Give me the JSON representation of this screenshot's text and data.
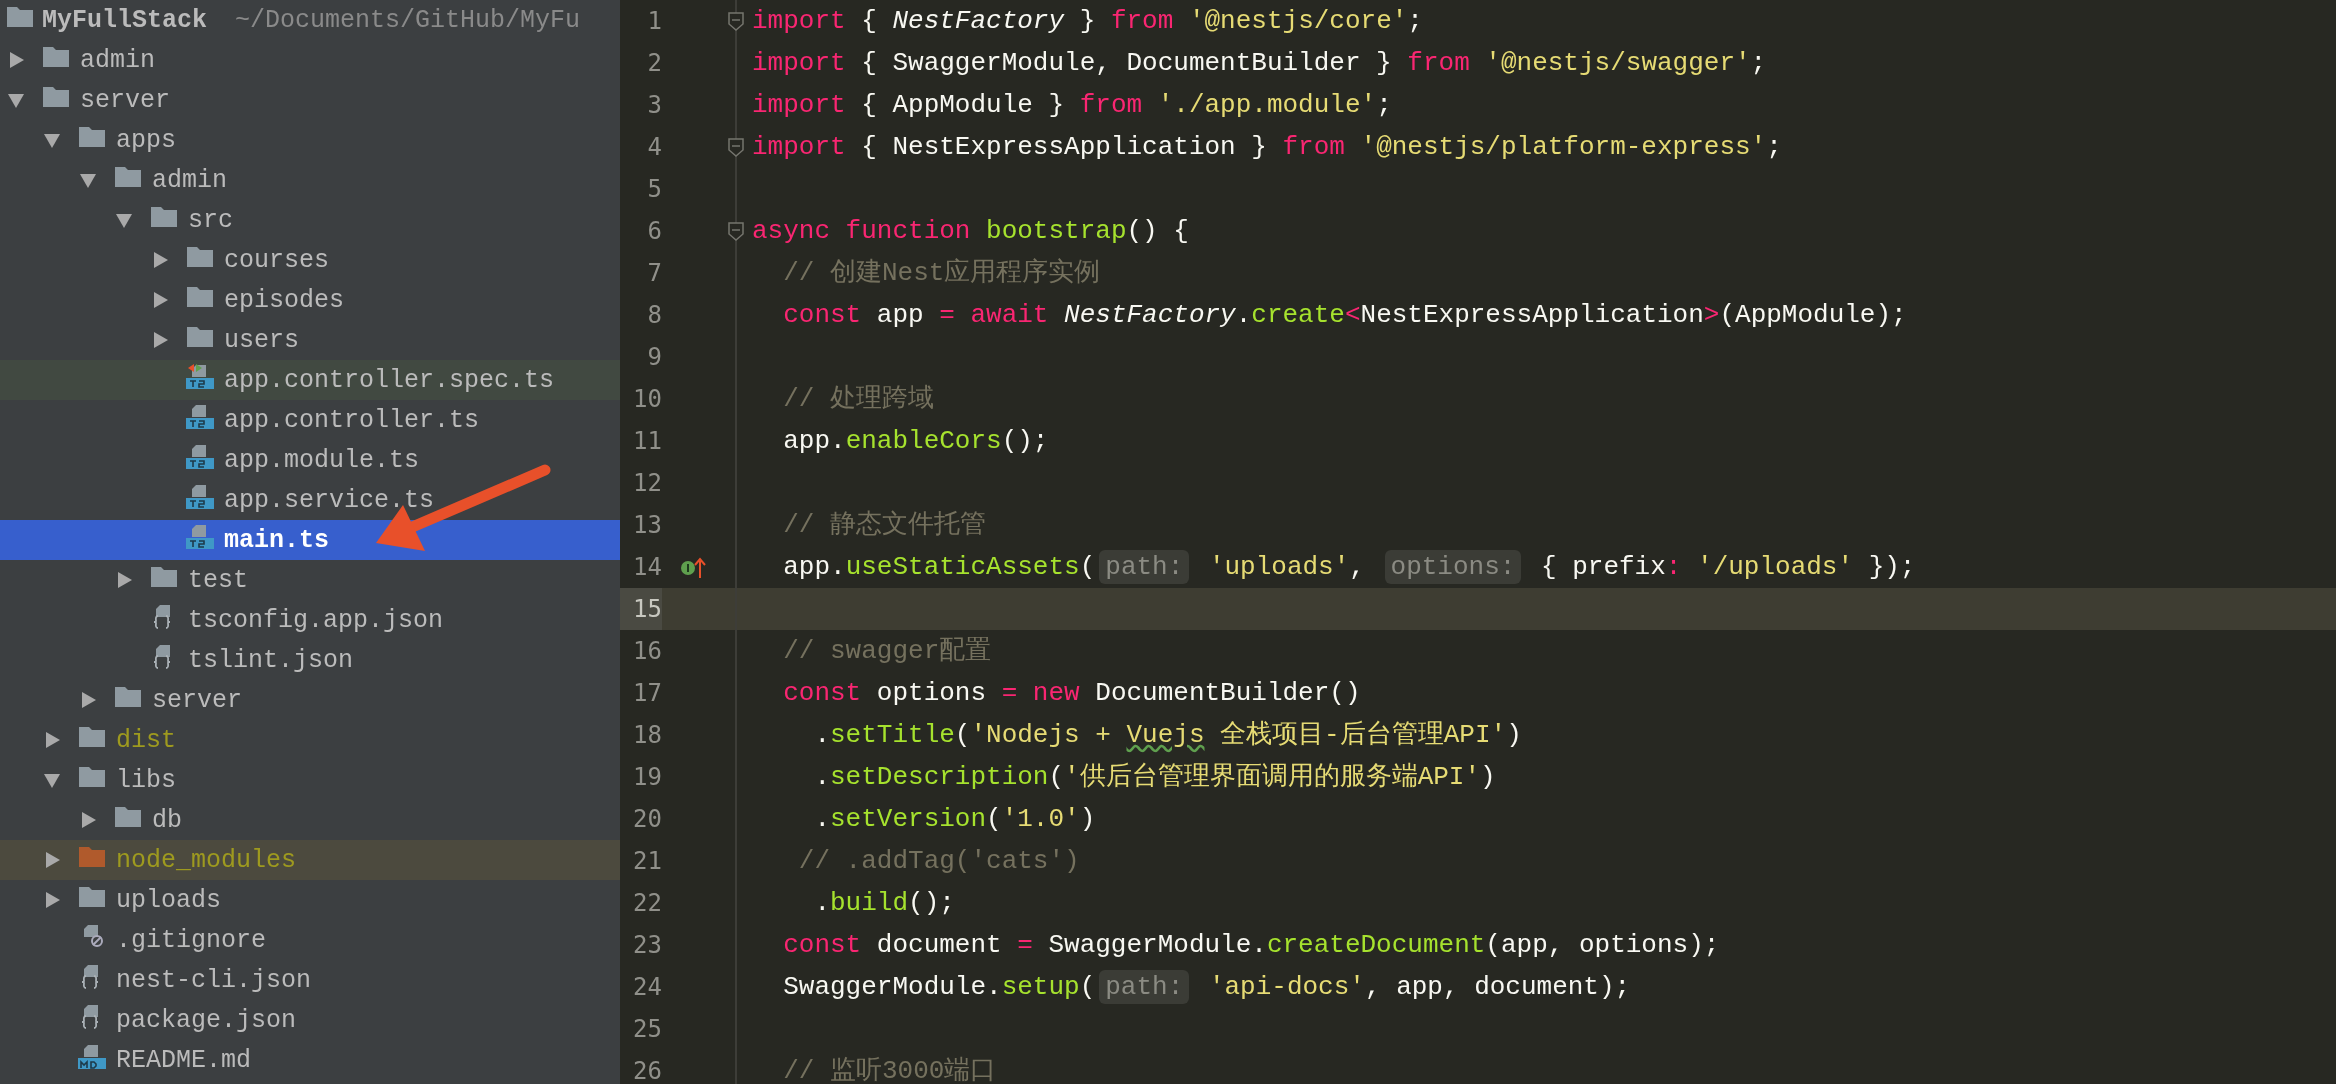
{
  "project": {
    "name": "MyFullStack",
    "path": "~/Documents/GitHub/MyFu"
  },
  "tree": {
    "items": [
      {
        "name": "admin",
        "kind": "folder",
        "expanded": false,
        "selected": false,
        "ignored": false,
        "excluded": false
      },
      {
        "name": "server",
        "kind": "folder",
        "expanded": true,
        "selected": false,
        "ignored": false,
        "excluded": false,
        "children": [
          {
            "name": "apps",
            "kind": "folder",
            "expanded": true,
            "selected": false,
            "ignored": false,
            "excluded": false,
            "children": [
              {
                "name": "admin",
                "kind": "folder",
                "expanded": true,
                "selected": false,
                "ignored": false,
                "excluded": false,
                "children": [
                  {
                    "name": "src",
                    "kind": "folder",
                    "expanded": true,
                    "selected": false,
                    "ignored": false,
                    "excluded": false,
                    "children": [
                      {
                        "name": "courses",
                        "kind": "folder",
                        "expanded": false,
                        "selected": false,
                        "ignored": false,
                        "excluded": false
                      },
                      {
                        "name": "episodes",
                        "kind": "folder",
                        "expanded": false,
                        "selected": false,
                        "ignored": false,
                        "excluded": false
                      },
                      {
                        "name": "users",
                        "kind": "folder",
                        "expanded": false,
                        "selected": false,
                        "ignored": false,
                        "excluded": false
                      },
                      {
                        "name": "app.controller.spec.ts",
                        "kind": "spec",
                        "selected": false,
                        "ignored": false,
                        "excluded": false
                      },
                      {
                        "name": "app.controller.ts",
                        "kind": "ts",
                        "selected": false,
                        "ignored": false,
                        "excluded": false
                      },
                      {
                        "name": "app.module.ts",
                        "kind": "ts",
                        "selected": false,
                        "ignored": false,
                        "excluded": false
                      },
                      {
                        "name": "app.service.ts",
                        "kind": "ts",
                        "selected": false,
                        "ignored": false,
                        "excluded": false
                      },
                      {
                        "name": "main.ts",
                        "kind": "ts",
                        "selected": true,
                        "ignored": false,
                        "excluded": false
                      }
                    ]
                  },
                  {
                    "name": "test",
                    "kind": "folder",
                    "expanded": false,
                    "selected": false,
                    "ignored": false,
                    "excluded": false
                  },
                  {
                    "name": "tsconfig.app.json",
                    "kind": "json",
                    "selected": false,
                    "ignored": false,
                    "excluded": false
                  },
                  {
                    "name": "tslint.json",
                    "kind": "json",
                    "selected": false,
                    "ignored": false,
                    "excluded": false
                  }
                ]
              },
              {
                "name": "server",
                "kind": "folder",
                "expanded": false,
                "selected": false,
                "ignored": false,
                "excluded": false
              }
            ]
          },
          {
            "name": "dist",
            "kind": "folder",
            "expanded": false,
            "selected": false,
            "ignored": true,
            "excluded": false
          },
          {
            "name": "libs",
            "kind": "folder",
            "expanded": true,
            "selected": false,
            "ignored": false,
            "excluded": false,
            "children": [
              {
                "name": "db",
                "kind": "folder",
                "expanded": false,
                "selected": false,
                "ignored": false,
                "excluded": false
              }
            ]
          },
          {
            "name": "node_modules",
            "kind": "folder",
            "expanded": false,
            "selected": false,
            "ignored": true,
            "excluded": true
          },
          {
            "name": "uploads",
            "kind": "folder",
            "expanded": false,
            "selected": false,
            "ignored": false,
            "excluded": false
          },
          {
            "name": ".gitignore",
            "kind": "ignore",
            "selected": false,
            "ignored": false,
            "excluded": false
          },
          {
            "name": "nest-cli.json",
            "kind": "json",
            "selected": false,
            "ignored": false,
            "excluded": false
          },
          {
            "name": "package.json",
            "kind": "json",
            "selected": false,
            "ignored": false,
            "excluded": false
          },
          {
            "name": "README.md",
            "kind": "md",
            "selected": false,
            "ignored": false,
            "excluded": false
          }
        ]
      }
    ]
  },
  "code": {
    "lines": [
      {
        "number": "1",
        "fold": true,
        "marker": false,
        "current": false,
        "tokens": [
          {
            "kind": "kw",
            "text": "import"
          },
          {
            "kind": "plain",
            "text": " { "
          },
          {
            "kind": "italic",
            "text": "NestFactory"
          },
          {
            "kind": "plain",
            "text": " } "
          },
          {
            "kind": "kw",
            "text": "from"
          },
          {
            "kind": "str",
            "text": " '@nestjs/core'"
          },
          {
            "kind": "plain",
            "text": ";"
          }
        ]
      },
      {
        "number": "2",
        "fold": false,
        "marker": false,
        "current": false,
        "tokens": [
          {
            "kind": "kw",
            "text": "import"
          },
          {
            "kind": "plain",
            "text": " { SwaggerModule, DocumentBuilder } "
          },
          {
            "kind": "kw",
            "text": "from"
          },
          {
            "kind": "str",
            "text": " '@nestjs/swagger'"
          },
          {
            "kind": "plain",
            "text": ";"
          }
        ]
      },
      {
        "number": "3",
        "fold": false,
        "marker": false,
        "current": false,
        "tokens": [
          {
            "kind": "kw",
            "text": "import"
          },
          {
            "kind": "plain",
            "text": " { AppModule } "
          },
          {
            "kind": "kw",
            "text": "from"
          },
          {
            "kind": "str",
            "text": " './app.module'"
          },
          {
            "kind": "plain",
            "text": ";"
          }
        ]
      },
      {
        "number": "4",
        "fold": true,
        "marker": false,
        "current": false,
        "tokens": [
          {
            "kind": "kw",
            "text": "import"
          },
          {
            "kind": "plain",
            "text": " { NestExpressApplication } "
          },
          {
            "kind": "kw",
            "text": "from"
          },
          {
            "kind": "str",
            "text": " '@nestjs/platform-express'"
          },
          {
            "kind": "plain",
            "text": ";"
          }
        ]
      },
      {
        "number": "5",
        "fold": false,
        "marker": false,
        "current": false
      },
      {
        "number": "6",
        "fold": true,
        "marker": false,
        "current": false,
        "tokens": [
          {
            "kind": "kw",
            "text": "async"
          },
          {
            "kind": "kw",
            "text": " function"
          },
          {
            "kind": "fn",
            "text": " bootstrap"
          },
          {
            "kind": "plain",
            "text": "() {"
          }
        ]
      },
      {
        "number": "7",
        "fold": false,
        "marker": false,
        "current": false,
        "tokens": [
          {
            "kind": "cmt",
            "text": "  // 创建Nest应用程序实例"
          }
        ]
      },
      {
        "number": "8",
        "fold": false,
        "marker": false,
        "current": false,
        "tokens": [
          {
            "kind": "kw",
            "text": "  const"
          },
          {
            "kind": "plain",
            "text": " app "
          },
          {
            "kind": "kw",
            "text": "="
          },
          {
            "kind": "kw",
            "text": " await"
          },
          {
            "kind": "italic",
            "text": " NestFactory"
          },
          {
            "kind": "plain",
            "text": "."
          },
          {
            "kind": "fn",
            "text": "create"
          },
          {
            "kind": "kw",
            "text": "<"
          },
          {
            "kind": "plain",
            "text": "NestExpressApplication"
          },
          {
            "kind": "kw",
            "text": ">"
          },
          {
            "kind": "plain",
            "text": "(AppModule);"
          }
        ]
      },
      {
        "number": "9",
        "fold": false,
        "marker": false,
        "current": false
      },
      {
        "number": "10",
        "fold": false,
        "marker": false,
        "current": false,
        "tokens": [
          {
            "kind": "cmt",
            "text": "  // 处理跨域"
          }
        ]
      },
      {
        "number": "11",
        "fold": false,
        "marker": false,
        "current": false,
        "tokens": [
          {
            "kind": "plain",
            "text": "  app."
          },
          {
            "kind": "fn",
            "text": "enableCors"
          },
          {
            "kind": "plain",
            "text": "();"
          }
        ]
      },
      {
        "number": "12",
        "fold": false,
        "marker": false,
        "current": false
      },
      {
        "number": "13",
        "fold": false,
        "marker": false,
        "current": false,
        "tokens": [
          {
            "kind": "cmt",
            "text": "  // 静态文件托管"
          }
        ]
      },
      {
        "number": "14",
        "fold": false,
        "marker": true,
        "current": false,
        "tokens": [
          {
            "kind": "plain",
            "text": "  app."
          },
          {
            "kind": "fn",
            "text": "useStaticAssets"
          },
          {
            "kind": "plain",
            "text": "("
          },
          {
            "kind": "hint",
            "text": "path:"
          },
          {
            "kind": "str",
            "text": " 'uploads'"
          },
          {
            "kind": "plain",
            "text": ", "
          },
          {
            "kind": "hint",
            "text": "options:"
          },
          {
            "kind": "plain",
            "text": " { prefix"
          },
          {
            "kind": "kw",
            "text": ":"
          },
          {
            "kind": "str",
            "text": " '/uploads'"
          },
          {
            "kind": "plain",
            "text": " });"
          }
        ]
      },
      {
        "number": "15",
        "fold": false,
        "marker": false,
        "current": true
      },
      {
        "number": "16",
        "fold": false,
        "marker": false,
        "current": false,
        "tokens": [
          {
            "kind": "cmt",
            "text": "  // swagger配置"
          }
        ]
      },
      {
        "number": "17",
        "fold": false,
        "marker": false,
        "current": false,
        "tokens": [
          {
            "kind": "kw",
            "text": "  const"
          },
          {
            "kind": "plain",
            "text": " options "
          },
          {
            "kind": "kw",
            "text": "="
          },
          {
            "kind": "kw",
            "text": " new"
          },
          {
            "kind": "plain",
            "text": " DocumentBuilder()"
          }
        ]
      },
      {
        "number": "18",
        "fold": false,
        "marker": false,
        "current": false,
        "tokens": [
          {
            "kind": "plain",
            "text": "    ."
          },
          {
            "kind": "fn",
            "text": "setTitle"
          },
          {
            "kind": "plain",
            "text": "("
          },
          {
            "kind": "str",
            "text": "'Nodejs + "
          },
          {
            "kind": "typo",
            "text": "Vuejs"
          },
          {
            "kind": "str",
            "text": " 全栈项目-后台管理API'"
          },
          {
            "kind": "plain",
            "text": ")"
          }
        ]
      },
      {
        "number": "19",
        "fold": false,
        "marker": false,
        "current": false,
        "tokens": [
          {
            "kind": "plain",
            "text": "    ."
          },
          {
            "kind": "fn",
            "text": "setDescription"
          },
          {
            "kind": "plain",
            "text": "("
          },
          {
            "kind": "str",
            "text": "'供后台管理界面调用的服务端API'"
          },
          {
            "kind": "plain",
            "text": ")"
          }
        ]
      },
      {
        "number": "20",
        "fold": false,
        "marker": false,
        "current": false,
        "tokens": [
          {
            "kind": "plain",
            "text": "    ."
          },
          {
            "kind": "fn",
            "text": "setVersion"
          },
          {
            "kind": "plain",
            "text": "("
          },
          {
            "kind": "str",
            "text": "'1.0'"
          },
          {
            "kind": "plain",
            "text": ")"
          }
        ]
      },
      {
        "number": "21",
        "fold": false,
        "marker": false,
        "current": false,
        "tokens": [
          {
            "kind": "cmt",
            "text": "   // .addTag('cats')"
          }
        ]
      },
      {
        "number": "22",
        "fold": false,
        "marker": false,
        "current": false,
        "tokens": [
          {
            "kind": "plain",
            "text": "    ."
          },
          {
            "kind": "fn",
            "text": "build"
          },
          {
            "kind": "plain",
            "text": "();"
          }
        ]
      },
      {
        "number": "23",
        "fold": false,
        "marker": false,
        "current": false,
        "tokens": [
          {
            "kind": "kw",
            "text": "  const"
          },
          {
            "kind": "plain",
            "text": " document "
          },
          {
            "kind": "kw",
            "text": "="
          },
          {
            "kind": "plain",
            "text": " SwaggerModule."
          },
          {
            "kind": "fn",
            "text": "createDocument"
          },
          {
            "kind": "plain",
            "text": "(app, options);"
          }
        ]
      },
      {
        "number": "24",
        "fold": false,
        "marker": false,
        "current": false,
        "tokens": [
          {
            "kind": "plain",
            "text": "  SwaggerModule."
          },
          {
            "kind": "fn",
            "text": "setup"
          },
          {
            "kind": "plain",
            "text": "("
          },
          {
            "kind": "hint",
            "text": "path:"
          },
          {
            "kind": "str",
            "text": " 'api-docs'"
          },
          {
            "kind": "plain",
            "text": ", app, document);"
          }
        ]
      },
      {
        "number": "25",
        "fold": false,
        "marker": false,
        "current": false
      },
      {
        "number": "26",
        "fold": false,
        "marker": false,
        "current": false,
        "tokens": [
          {
            "kind": "cmt",
            "text": "  // 监听3000端口"
          }
        ]
      }
    ]
  }
}
